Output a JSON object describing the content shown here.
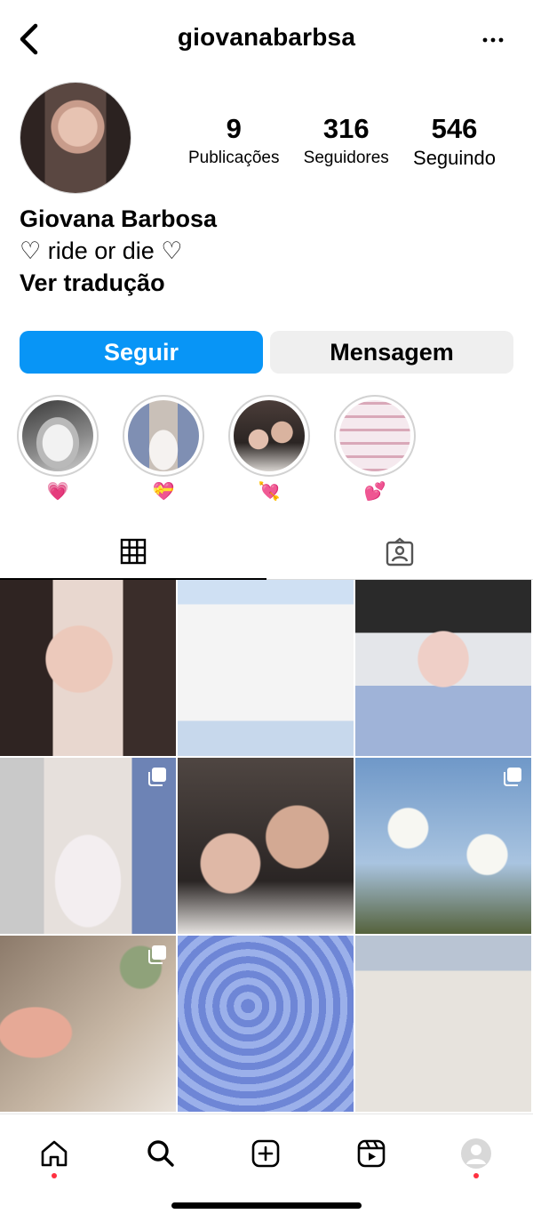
{
  "header": {
    "username": "giovanabarbsa",
    "back_icon": "chevron-left-icon",
    "more_icon": "more-horizontal-icon"
  },
  "profile": {
    "stats": [
      {
        "value": "9",
        "label": "Publicações"
      },
      {
        "value": "316",
        "label": "Seguidores"
      },
      {
        "value": "546",
        "label": "Seguindo"
      }
    ],
    "name": "Giovana Barbosa",
    "bio": "♡ ride or die ♡",
    "translate": "Ver tradução"
  },
  "actions": {
    "follow": "Seguir",
    "message": "Mensagem"
  },
  "highlights": [
    {
      "label": "💗"
    },
    {
      "label": "💝"
    },
    {
      "label": "💘"
    },
    {
      "label": "💕"
    }
  ],
  "tabs": [
    "grid-icon",
    "tagged-icon"
  ],
  "posts_multi_flags": [
    false,
    false,
    false,
    true,
    false,
    true,
    true,
    false,
    false
  ],
  "bottom_nav": [
    "home-icon",
    "search-icon",
    "create-icon",
    "reels-icon",
    "profile-icon"
  ],
  "colors": {
    "accent": "#0895f6",
    "notification_dot": "#ff3040"
  }
}
